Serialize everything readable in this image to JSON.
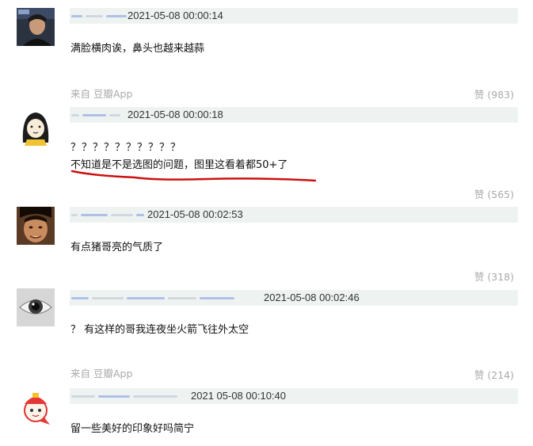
{
  "comments": [
    {
      "timestamp": "2021-05-08 00:00:14",
      "text": "满脸横肉诶，鼻头也越来越蒜",
      "source": "来自 豆瓣App",
      "likes": "赞 (983)"
    },
    {
      "timestamp": "2021-05-08 00:00:18",
      "text": "？？？？？？？？？？",
      "text2": "不知道是不是选图的问题，图里这看着都50+了",
      "likes": "赞 (565)"
    },
    {
      "timestamp": "2021-05-08 00:02:53",
      "text": "有点猪哥亮的气质了",
      "likes": "赞 (318)"
    },
    {
      "timestamp": "2021-05-08 00:02:46",
      "text": "？ 有这样的哥我连夜坐火箭飞往外太空",
      "source": "来自 豆瓣App",
      "likes": "赞 (214)"
    },
    {
      "timestamp": "2021 05-08 00:10:40",
      "text": "留一些美好的印象好吗简宁"
    }
  ],
  "colors": {
    "meta_bar_bg": "#eef3f2",
    "muted_text": "#aaaaaa",
    "annotation_red": "#cc1111"
  }
}
